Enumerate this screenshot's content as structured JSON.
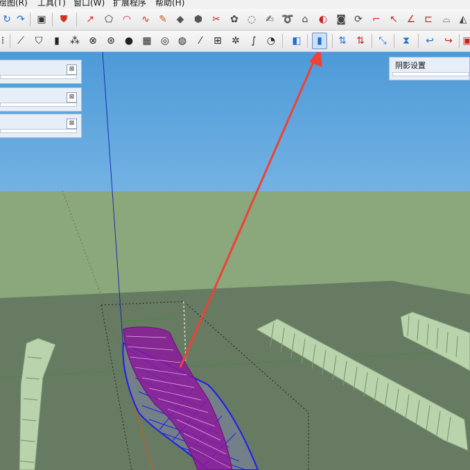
{
  "menubar": {
    "items": [
      "绘图(R)",
      "工具(T)",
      "窗口(W)",
      "扩展程序",
      "帮助(H)"
    ]
  },
  "toolbar1": {
    "icons": [
      "rotate-cw-icon",
      "redo-icon",
      "cube-icon",
      "shield-red-icon",
      "dimension-icon",
      "polygon-icon",
      "arc-icon",
      "spline-icon",
      "paint-icon",
      "box-icon",
      "shape-icon",
      "scissors-icon",
      "shell-icon",
      "rounded-icon",
      "freehand-icon",
      "curve-icon",
      "loft-icon",
      "sphere-icon",
      "extrude-icon",
      "lathe-icon",
      "path-icon",
      "arc-corner-icon",
      "angle-icon",
      "line-icon",
      "flatten-icon",
      "view-icon"
    ]
  },
  "toolbar2": {
    "icons": [
      "sweep-icon",
      "feather-icon",
      "shield-icon",
      "panel-icon",
      "link-icon",
      "chain-icon",
      "spin-icon",
      "water-icon",
      "grid-icon",
      "target-icon",
      "tool-icon",
      "slash-icon",
      "fourcircles-icon",
      "gear-icon",
      "wave-icon",
      "spiral-icon",
      "cube-color-icon",
      "cube-blue-icon",
      "arrows-updown-icon",
      "arrows-red-icon",
      "diagonal-icon",
      "hourglass-icon",
      "hook-icon",
      "curve-red-icon"
    ],
    "active_index": 17
  },
  "panels": {
    "tray_count": 3,
    "shadow_panel_title": "阴影设置"
  },
  "colors": {
    "sky_top": "#4d9ad8",
    "ground": "#8aa87b",
    "magenta_mesh": "#8b1a9b",
    "blue_mesh": "#1d1df0",
    "arrow_red": "#ef4136",
    "bush_green": "#b9d3ad"
  }
}
